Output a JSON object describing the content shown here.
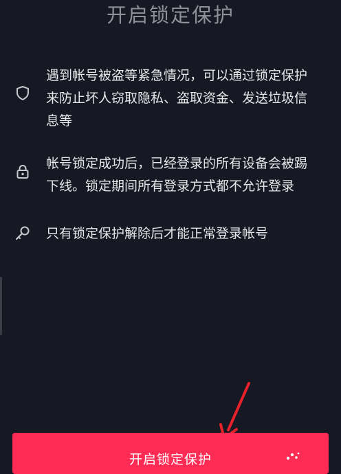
{
  "page": {
    "title": "开启锁定保护"
  },
  "features": [
    {
      "icon": "shield-icon",
      "lines": [
        "遇到帐号被盗等紧急情况，可以通过锁定保护",
        "来防止坏人窃取隐私、盗取资金、发送垃圾信",
        "息等"
      ]
    },
    {
      "icon": "lock-icon",
      "lines": [
        "帐号锁定成功后，已经登录的所有设备会被踢",
        "下线。锁定期间所有登录方式都不允许登录"
      ]
    },
    {
      "icon": "key-icon",
      "lines": [
        "只有锁定保护解除后才能正常登录帐号"
      ]
    }
  ],
  "action": {
    "button_label": "开启锁定保护"
  },
  "colors": {
    "background": "#161823",
    "accent": "#fe2c55",
    "arrow": "#e8222b"
  }
}
